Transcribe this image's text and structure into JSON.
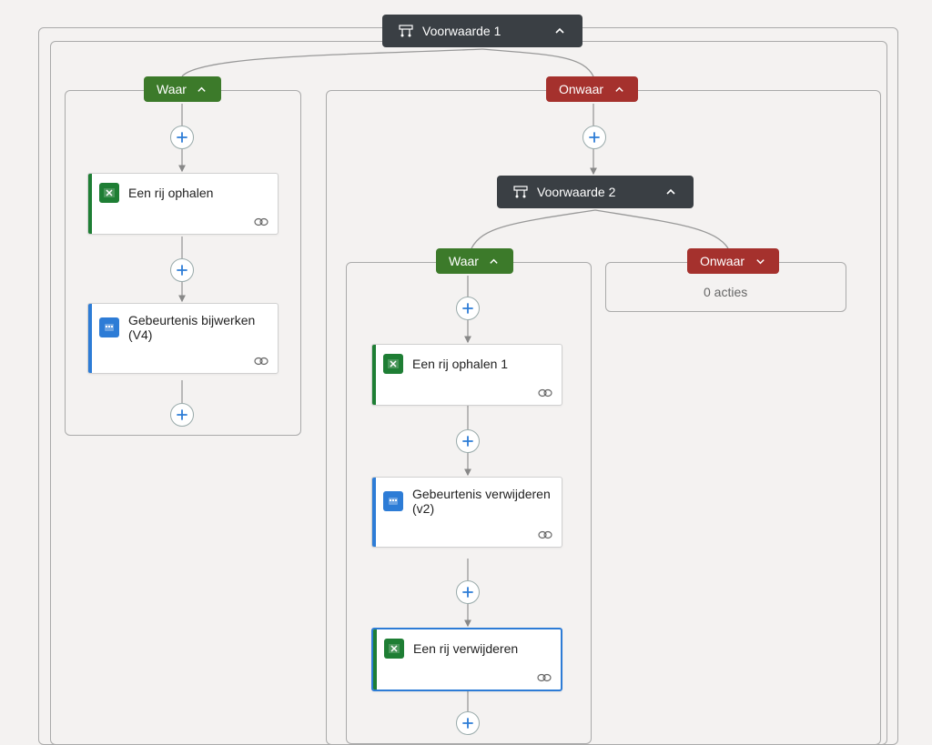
{
  "condition1": {
    "label": "Voorwaarde 1"
  },
  "branch_true": "Waar",
  "branch_false": "Onwaar",
  "left_branch": {
    "actions": [
      {
        "label": "Een rij ophalen",
        "icon": "excel",
        "bar": "green"
      },
      {
        "label": "Gebeurtenis bijwerken (V4)",
        "icon": "outlook",
        "bar": "blue"
      }
    ]
  },
  "condition2": {
    "label": "Voorwaarde 2"
  },
  "nested_true": {
    "actions": [
      {
        "label": "Een rij ophalen 1",
        "icon": "excel",
        "bar": "green"
      },
      {
        "label": "Gebeurtenis verwijderen (v2)",
        "icon": "outlook",
        "bar": "blue"
      },
      {
        "label": "Een rij verwijderen",
        "icon": "excel",
        "bar": "green",
        "selected": true
      }
    ]
  },
  "nested_false": {
    "empty_text": "0 acties"
  }
}
